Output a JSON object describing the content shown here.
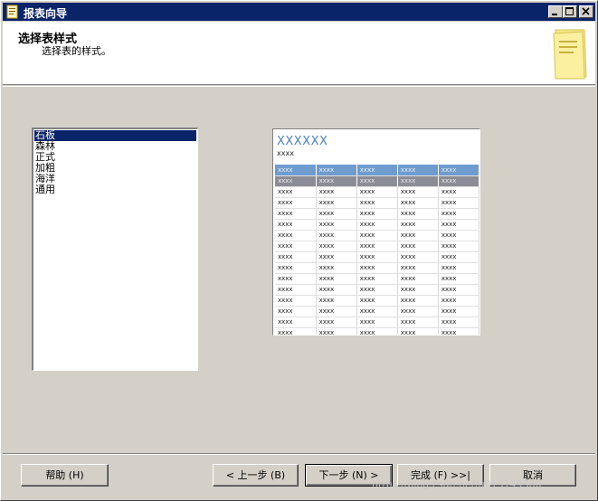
{
  "window": {
    "title": "报表向导"
  },
  "header": {
    "title": "选择表样式",
    "subtitle": "选择表的样式。"
  },
  "styles": {
    "items": [
      "石板",
      "森林",
      "正式",
      "加粗",
      "海洋",
      "通用"
    ],
    "selected": "石板"
  },
  "preview": {
    "title": "XXXXXX",
    "subtitle": "xxxx",
    "cell": "xxxx",
    "header_row_color": "#6f9ccf",
    "group_row_color": "#8c8c96",
    "title_color": "#4f81bd"
  },
  "buttons": {
    "help": "帮助 (H)",
    "back": "< 上一步 (B)",
    "next": "下一步 (N) >",
    "finish": "完成 (F) >>|",
    "cancel": "取消"
  },
  "watermark": "https://blog.csdn.net/u013149380"
}
